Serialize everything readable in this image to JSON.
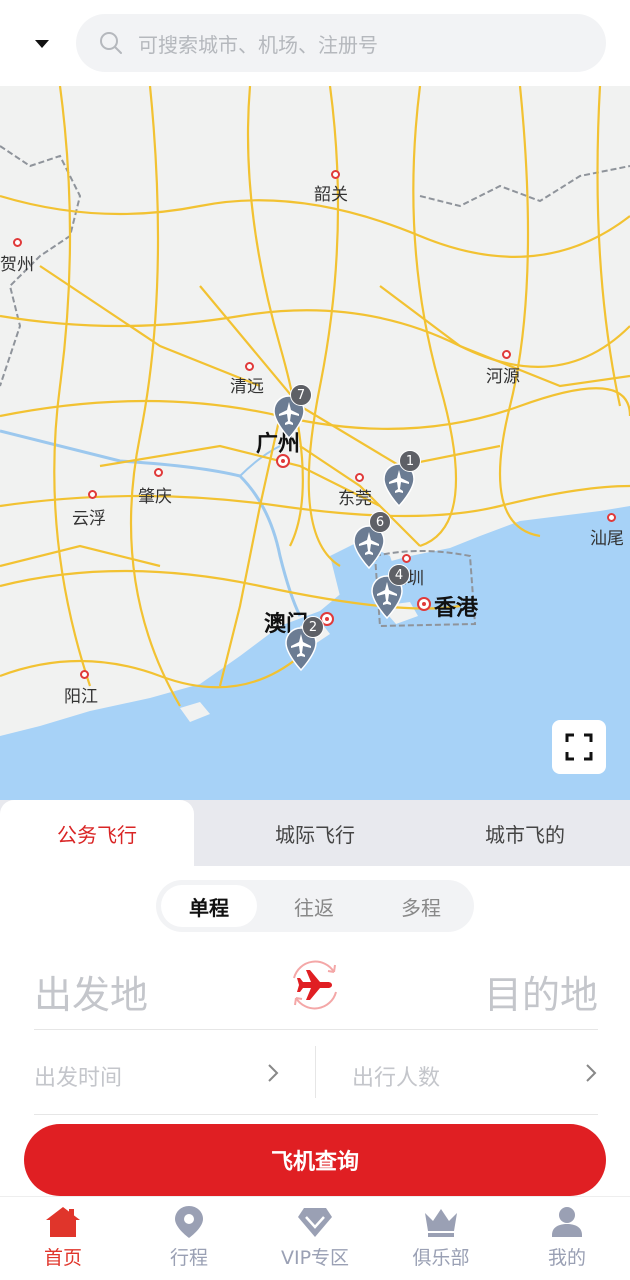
{
  "header": {
    "search_placeholder": "可搜索城市、机场、注册号"
  },
  "map": {
    "cities": {
      "shaoguan": "韶关",
      "hezhou": "贺州",
      "qingyuan": "清远",
      "heyuan": "河源",
      "guangzhou": "广州",
      "zhaoqing": "肇庆",
      "yunfu": "云浮",
      "dongguan": "东莞",
      "shanwei": "汕尾",
      "shenzhen": "深圳",
      "hongkong": "香港",
      "macau": "澳门",
      "yangjiang": "阳江"
    },
    "clusters": [
      {
        "count": "7"
      },
      {
        "count": "1"
      },
      {
        "count": "6"
      },
      {
        "count": "4"
      },
      {
        "count": "2"
      }
    ]
  },
  "tabs": [
    "公务飞行",
    "城际飞行",
    "城市飞的"
  ],
  "trip_types": [
    "单程",
    "往返",
    "多程"
  ],
  "form": {
    "origin": "出发地",
    "destination": "目的地",
    "depart_time": "出发时间",
    "passengers": "出行人数"
  },
  "search_button": "飞机查询",
  "nav": [
    "首页",
    "行程",
    "VIP专区",
    "俱乐部",
    "我的"
  ],
  "colors": {
    "accent": "#e01f23",
    "nav_inactive": "#9aa0b4",
    "sea": "#a7d2f7",
    "road": "#f2c232"
  }
}
